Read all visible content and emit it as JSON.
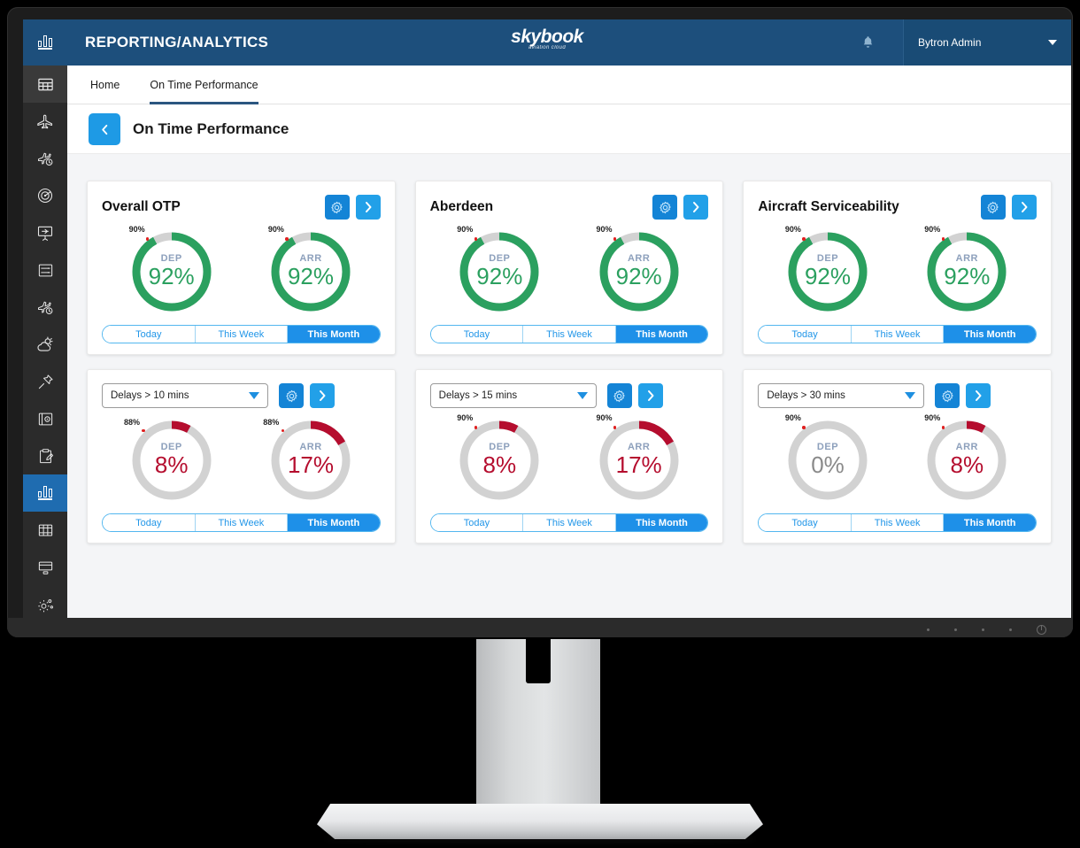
{
  "header": {
    "logo_icon": "bar-chart-icon",
    "title": "REPORTING/ANALYTICS",
    "brand_main": "skybook",
    "brand_sub": "aviation cloud",
    "bell_icon": "notification-bell-icon",
    "user_name": "Bytron Admin",
    "caret_icon": "chevron-down-icon",
    "bar_color": "#1d4f7c"
  },
  "sidebar": {
    "items": [
      {
        "icon": "grid-icon",
        "state": "hover"
      },
      {
        "icon": "aircraft-icon",
        "state": "normal"
      },
      {
        "icon": "aircraft-clock-icon",
        "state": "normal"
      },
      {
        "icon": "radar-icon",
        "state": "normal"
      },
      {
        "icon": "briefing-board-icon",
        "state": "normal"
      },
      {
        "icon": "server-rack-icon",
        "state": "normal"
      },
      {
        "icon": "flight-tracking-icon",
        "state": "normal"
      },
      {
        "icon": "weather-icon",
        "state": "normal"
      },
      {
        "icon": "pin-icon",
        "state": "normal"
      },
      {
        "icon": "safe-icon",
        "state": "normal"
      },
      {
        "icon": "clipboard-edit-icon",
        "state": "normal"
      },
      {
        "icon": "bar-chart-icon",
        "state": "selected"
      },
      {
        "icon": "library-icon",
        "state": "normal"
      },
      {
        "icon": "window-icon",
        "state": "normal"
      },
      {
        "icon": "settings-gears-icon",
        "state": "normal"
      }
    ],
    "selected_color": "#1f6cb0"
  },
  "tabs": [
    {
      "label": "Home",
      "active": false
    },
    {
      "label": "On Time Performance",
      "active": true
    }
  ],
  "page": {
    "back_icon": "chevron-left-icon",
    "title": "On Time Performance"
  },
  "cards": [
    {
      "id": "overall-otp",
      "title": "Overall OTP",
      "has_dropdown": false,
      "gear_icon": "gear-icon",
      "next_icon": "chevron-right-icon",
      "gauges": [
        {
          "label": "DEP",
          "value": "92%",
          "percent": 92,
          "target_label": "90%",
          "target_percent": 90,
          "color": "green"
        },
        {
          "label": "ARR",
          "value": "92%",
          "percent": 92,
          "target_label": "90%",
          "target_percent": 90,
          "color": "green"
        }
      ],
      "segments": [
        {
          "label": "Today",
          "active": false
        },
        {
          "label": "This Week",
          "active": false
        },
        {
          "label": "This Month",
          "active": true
        }
      ]
    },
    {
      "id": "aberdeen",
      "title": "Aberdeen",
      "has_dropdown": false,
      "gear_icon": "gear-icon",
      "next_icon": "chevron-right-icon",
      "gauges": [
        {
          "label": "DEP",
          "value": "92%",
          "percent": 92,
          "target_label": "90%",
          "target_percent": 90,
          "color": "green"
        },
        {
          "label": "ARR",
          "value": "92%",
          "percent": 92,
          "target_label": "90%",
          "target_percent": 90,
          "color": "green"
        }
      ],
      "segments": [
        {
          "label": "Today",
          "active": false
        },
        {
          "label": "This Week",
          "active": false
        },
        {
          "label": "This Month",
          "active": true
        }
      ]
    },
    {
      "id": "aircraft-serviceability",
      "title": "Aircraft Serviceability",
      "has_dropdown": false,
      "gear_icon": "gear-icon",
      "next_icon": "chevron-right-icon",
      "gauges": [
        {
          "label": "DEP",
          "value": "92%",
          "percent": 92,
          "target_label": "90%",
          "target_percent": 90,
          "color": "green"
        },
        {
          "label": "ARR",
          "value": "92%",
          "percent": 92,
          "target_label": "90%",
          "target_percent": 90,
          "color": "green"
        }
      ],
      "segments": [
        {
          "label": "Today",
          "active": false
        },
        {
          "label": "This Week",
          "active": false
        },
        {
          "label": "This Month",
          "active": true
        }
      ]
    },
    {
      "id": "delays-10",
      "title": "",
      "has_dropdown": true,
      "dropdown_value": "Delays > 10 mins",
      "dropdown_icon": "chevron-down-icon",
      "gear_icon": "gear-icon",
      "next_icon": "chevron-right-icon",
      "gauges": [
        {
          "label": "DEP",
          "value": "8%",
          "percent": 8,
          "target_label": "88%",
          "target_percent": 88,
          "color": "red"
        },
        {
          "label": "ARR",
          "value": "17%",
          "percent": 17,
          "target_label": "88%",
          "target_percent": 88,
          "color": "red"
        }
      ],
      "segments": [
        {
          "label": "Today",
          "active": false
        },
        {
          "label": "This Week",
          "active": false
        },
        {
          "label": "This Month",
          "active": true
        }
      ]
    },
    {
      "id": "delays-15",
      "title": "",
      "has_dropdown": true,
      "dropdown_value": "Delays > 15 mins",
      "dropdown_icon": "chevron-down-icon",
      "gear_icon": "gear-icon",
      "next_icon": "chevron-right-icon",
      "gauges": [
        {
          "label": "DEP",
          "value": "8%",
          "percent": 8,
          "target_label": "90%",
          "target_percent": 90,
          "color": "red"
        },
        {
          "label": "ARR",
          "value": "17%",
          "percent": 17,
          "target_label": "90%",
          "target_percent": 90,
          "color": "red"
        }
      ],
      "segments": [
        {
          "label": "Today",
          "active": false
        },
        {
          "label": "This Week",
          "active": false
        },
        {
          "label": "This Month",
          "active": true
        }
      ]
    },
    {
      "id": "delays-30",
      "title": "",
      "has_dropdown": true,
      "dropdown_value": "Delays > 30 mins",
      "dropdown_icon": "chevron-down-icon",
      "gear_icon": "gear-icon",
      "next_icon": "chevron-right-icon",
      "gauges": [
        {
          "label": "DEP",
          "value": "0%",
          "percent": 0,
          "target_label": "90%",
          "target_percent": 90,
          "color": "grey"
        },
        {
          "label": "ARR",
          "value": "8%",
          "percent": 8,
          "target_label": "90%",
          "target_percent": 90,
          "color": "red"
        }
      ],
      "segments": [
        {
          "label": "Today",
          "active": false
        },
        {
          "label": "This Week",
          "active": false
        },
        {
          "label": "This Month",
          "active": true
        }
      ]
    }
  ],
  "monitor": {
    "chin_dots": 4,
    "power_icon": "power-icon"
  },
  "colors": {
    "green": "#2ba05f",
    "red": "#b50d2e",
    "grey_track": "#d2d2d2",
    "blue_accent": "#1e9ae5",
    "header_blue": "#1d4f7c"
  }
}
